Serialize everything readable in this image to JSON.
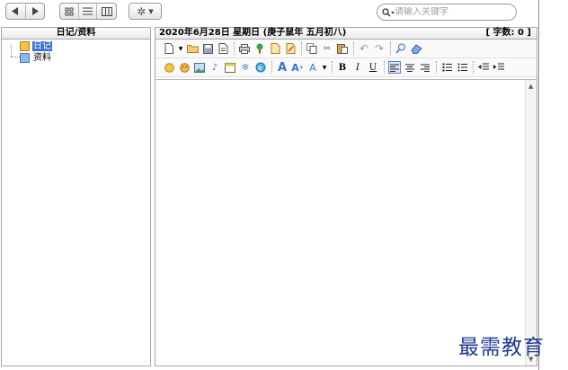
{
  "toolbar": {
    "nav_back_icon": "triangle-left",
    "nav_forward_icon": "triangle-right",
    "view_icons": [
      "grid-view-icon",
      "list-view-icon",
      "column-view-icon"
    ],
    "settings_icon": "gear-icon",
    "search": {
      "placeholder": "请输入关键字",
      "icon": "search-icon"
    }
  },
  "left_panel": {
    "header": "日记/资料",
    "tree": [
      {
        "label": "日记",
        "selected": true,
        "icon": "diary-book-icon"
      },
      {
        "label": "资料",
        "selected": false,
        "icon": "document-icon"
      }
    ]
  },
  "editor": {
    "date_header": "2020年6月28日  星期日  (庚子鼠年  五月初八)",
    "word_count": "[ 字数: 0 ]"
  },
  "colors": {
    "selection": "#3a6fd8",
    "watermark": "#1f3b96"
  },
  "watermark_text": "最需教育"
}
